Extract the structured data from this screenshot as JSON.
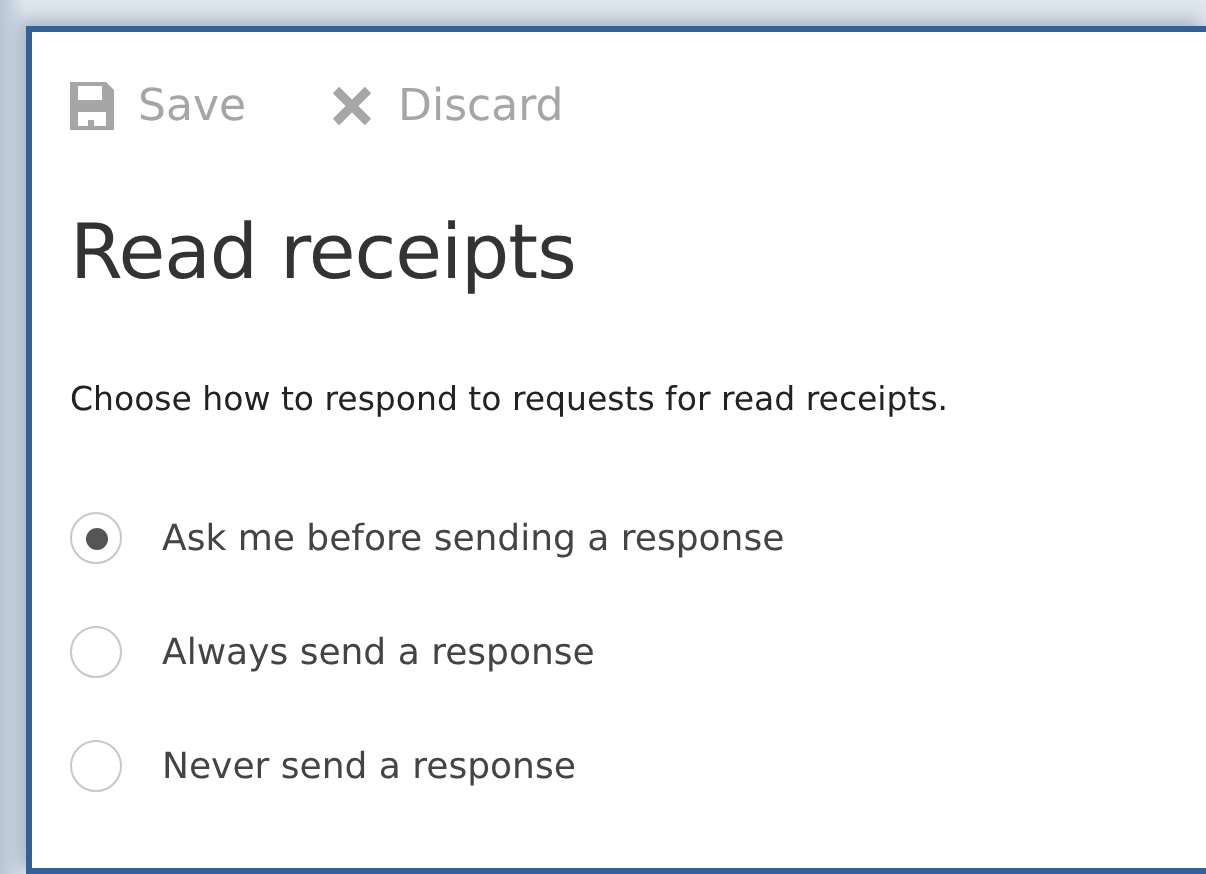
{
  "toolbar": [
    {
      "kind": "save",
      "label": "Save",
      "disabled": true
    },
    {
      "kind": "discard",
      "label": "Discard",
      "disabled": true
    }
  ],
  "title": "Read receipts",
  "description": "Choose how to respond to requests for read receipts.",
  "options": [
    {
      "label": "Ask me before sending a response",
      "selected": true
    },
    {
      "label": "Always send a response",
      "selected": false
    },
    {
      "label": "Never send a response",
      "selected": false
    }
  ]
}
